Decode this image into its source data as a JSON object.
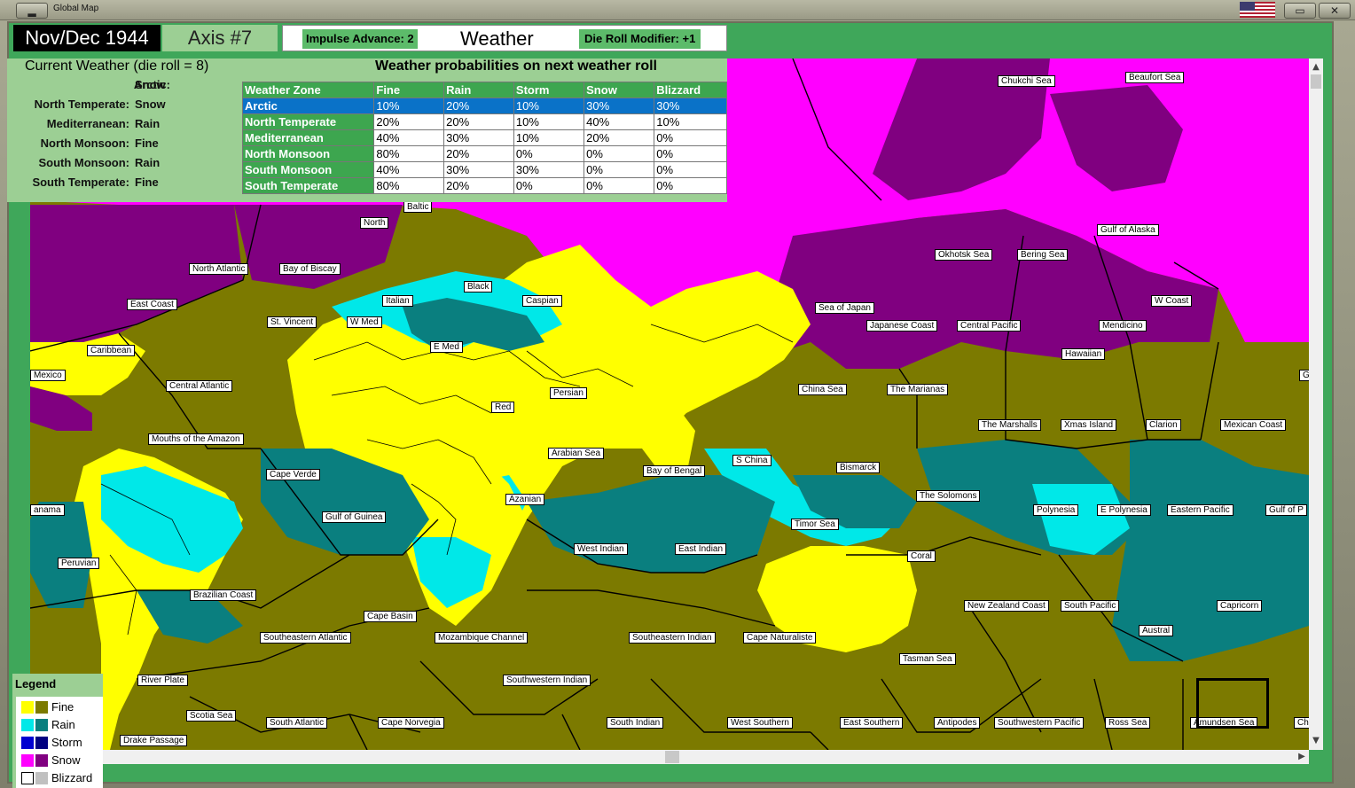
{
  "window": {
    "title": "Global Map"
  },
  "header": {
    "date": "Nov/Dec 1944",
    "turn": "Axis #7",
    "impulse_advance": "Impulse Advance:  2",
    "tab": "Weather",
    "die_roll_modifier": "Die Roll Modifier:  +1"
  },
  "current_weather": {
    "title": "Current Weather (die roll = 8)",
    "zones": [
      {
        "zone": "Arctic:",
        "value": "Snow"
      },
      {
        "zone": "North Temperate:",
        "value": "Snow"
      },
      {
        "zone": "Mediterranean:",
        "value": "Rain"
      },
      {
        "zone": "North Monsoon:",
        "value": "Fine"
      },
      {
        "zone": "South Monsoon:",
        "value": "Rain"
      },
      {
        "zone": "South Temperate:",
        "value": "Fine"
      }
    ]
  },
  "probabilities": {
    "title": "Weather probabilities on next weather roll",
    "headers": [
      "Weather Zone",
      "Fine",
      "Rain",
      "Storm",
      "Snow",
      "Blizzard"
    ],
    "rows": [
      {
        "zone": "Arctic",
        "fine": "10%",
        "rain": "20%",
        "storm": "10%",
        "snow": "30%",
        "blizzard": "30%"
      },
      {
        "zone": "North Temperate",
        "fine": "20%",
        "rain": "20%",
        "storm": "10%",
        "snow": "40%",
        "blizzard": "10%"
      },
      {
        "zone": "Mediterranean",
        "fine": "40%",
        "rain": "30%",
        "storm": "10%",
        "snow": "20%",
        "blizzard": "0%"
      },
      {
        "zone": "North Monsoon",
        "fine": "80%",
        "rain": "20%",
        "storm": "0%",
        "snow": "0%",
        "blizzard": "0%"
      },
      {
        "zone": "South Monsoon",
        "fine": "40%",
        "rain": "30%",
        "storm": "30%",
        "snow": "0%",
        "blizzard": "0%"
      },
      {
        "zone": "South Temperate",
        "fine": "80%",
        "rain": "20%",
        "storm": "0%",
        "snow": "0%",
        "blizzard": "0%"
      }
    ],
    "selected_row": "Arctic"
  },
  "legend": {
    "title": "Legend",
    "items": [
      {
        "label": "Fine",
        "land": "#ffff00",
        "sea": "#7c7a00"
      },
      {
        "label": "Rain",
        "land": "#00e8e8",
        "sea": "#0a7f7f"
      },
      {
        "label": "Storm",
        "land": "#0000d0",
        "sea": "#000080"
      },
      {
        "label": "Snow",
        "land": "#ff00ff",
        "sea": "#800080"
      },
      {
        "label": "Blizzard",
        "land": "#ffffff",
        "sea": "#c0c0c0"
      }
    ]
  },
  "map_labels": {
    "chukchi_sea": "Chukchi Sea",
    "beaufort_sea": "Beaufort Sea",
    "baltic": "Baltic",
    "north": "North",
    "north_atlantic": "North Atlantic",
    "bay_of_biscay": "Bay of Biscay",
    "black": "Black",
    "east_coast": "East Coast",
    "italian": "Italian",
    "caspian": "Caspian",
    "st_vincent": "St. Vincent",
    "w_med": "W Med",
    "okhotsk_sea": "Okhotsk Sea",
    "bering_sea": "Bering Sea",
    "gulf_of_alaska": "Gulf of Alaska",
    "sea_of_japan": "Sea of Japan",
    "w_coast": "W Coast",
    "japanese_coast": "Japanese Coast",
    "central_pacific": "Central Pacific",
    "mendicino": "Mendicino",
    "caribbean": "Caribbean",
    "e_med": "E Med",
    "hawaiian": "Hawaiian",
    "mexico": "Mexico",
    "central_atlantic": "Central Atlantic",
    "persian": "Persian",
    "china_sea": "China Sea",
    "the_marianas": "The Marianas",
    "red": "Red",
    "mouths_of_the_amazon": "Mouths of the Amazon",
    "the_marshalls": "The Marshalls",
    "xmas_island": "Xmas Island",
    "clarion": "Clarion",
    "mexican_coast": "Mexican Coast",
    "arabian_sea": "Arabian Sea",
    "s_china": "S China",
    "bismarck": "Bismarck",
    "bay_of_bengal": "Bay of Bengal",
    "cape_verde": "Cape Verde",
    "the_solomons": "The Solomons",
    "azanian": "Azanian",
    "anama": "anama",
    "polynesia": "Polynesia",
    "e_polynesia": "E Polynesia",
    "eastern_pacific": "Eastern Pacific",
    "gulf_of_p": "Gulf of P",
    "gulf_of_guinea": "Gulf of Guinea",
    "timor_sea": "Timor Sea",
    "west_indian": "West Indian",
    "east_indian": "East Indian",
    "coral": "Coral",
    "peruvian": "Peruvian",
    "brazilian_coast": "Brazilian Coast",
    "new_zealand_coast": "New Zealand Coast",
    "south_pacific": "South Pacific",
    "capricorn": "Capricorn",
    "cape_basin": "Cape Basin",
    "austral": "Austral",
    "southeastern_atlantic": "Southeastern Atlantic",
    "mozambique_channel": "Mozambique Channel",
    "southeastern_indian": "Southeastern Indian",
    "cape_naturaliste": "Cape Naturaliste",
    "tasman_sea": "Tasman Sea",
    "river_plate": "River Plate",
    "southwestern_indian": "Southwestern Indian",
    "scotia_sea": "Scotia Sea",
    "south_atlantic": "South Atlantic",
    "cape_norvegia": "Cape Norvegia",
    "south_indian": "South Indian",
    "west_southern": "West Southern",
    "east_southern": "East Southern",
    "antipodes": "Antipodes",
    "southwestern_pacific": "Southwestern Pacific",
    "ross_sea": "Ross Sea",
    "amundsen_sea": "Amundsen Sea",
    "drake_passage": "Drake Passage",
    "g": "G",
    "ch": "Ch"
  },
  "colors": {
    "panel_green": "#9ccf94",
    "frame_green": "#3fa75a",
    "header_green": "#3da64f",
    "selected_blue": "#0a72c8"
  }
}
